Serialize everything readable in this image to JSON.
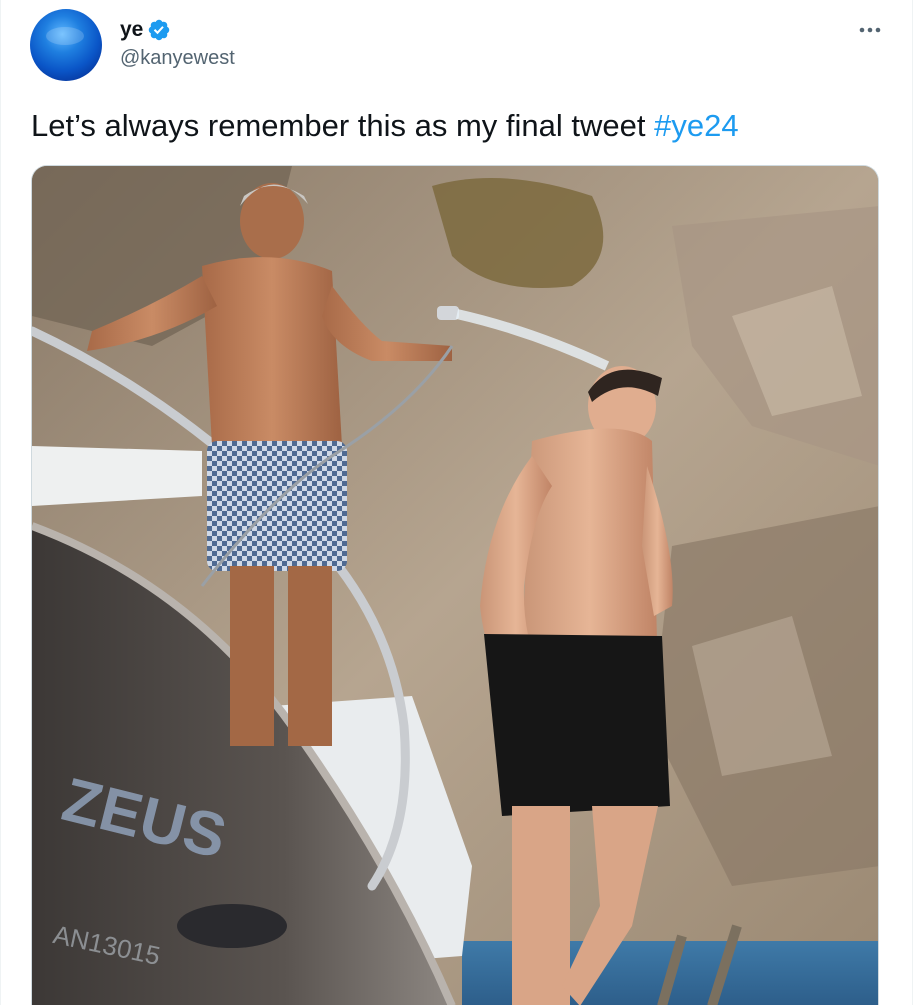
{
  "tweet": {
    "author": {
      "display_name": "ye",
      "handle": "@kanyewest",
      "verified": true,
      "avatar_icon": "blue-sphere-avatar"
    },
    "text": "Let’s always remember this as my final tweet ",
    "hashtag": "#ye24",
    "media": {
      "description_icon": "photo",
      "hull_lettering": "ZEUS",
      "hull_number": "AN13015"
    }
  },
  "icons": {
    "verified": "verified-badge-icon",
    "more": "more-options-icon"
  },
  "colors": {
    "accent": "#1d9bf0",
    "text": "#0f1419",
    "secondary_text": "#536471",
    "border": "#cfd9de"
  }
}
